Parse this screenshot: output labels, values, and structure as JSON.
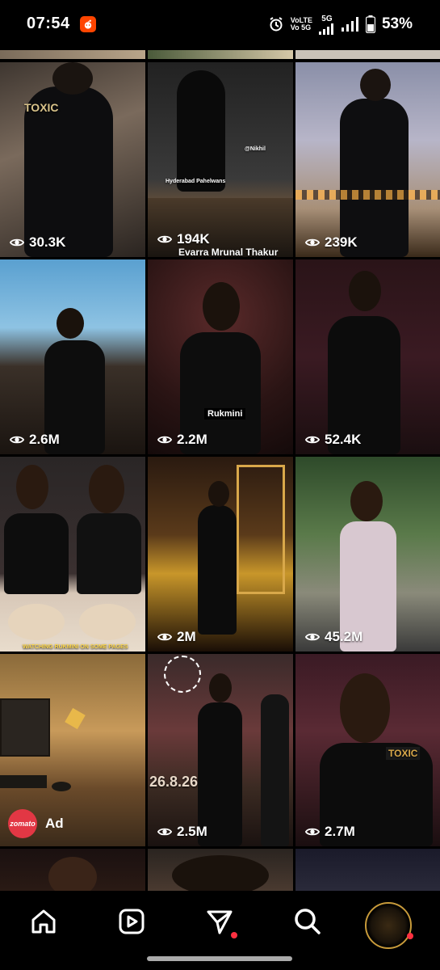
{
  "status_bar": {
    "time": "07:54",
    "app_icon": "reddit-icon",
    "network_volte": "VoLTE",
    "network_vo5g": "Vo 5G",
    "network_5g": "5G",
    "battery_percent": "53%",
    "icons": [
      "alarm-icon",
      "signal-icon",
      "battery-icon"
    ]
  },
  "grid": {
    "tiles": [
      {
        "views": "30.3K",
        "overlay": "TOXIC"
      },
      {
        "views": "194K",
        "overlay": "Evarra Mrunal Thakur",
        "overlay2": "Hyderabad Pahelwans",
        "overlay3": "@Nikhil"
      },
      {
        "views": "239K"
      },
      {
        "views": "2.6M"
      },
      {
        "views": "2.2M",
        "overlay": "Rukmini"
      },
      {
        "views": "52.4K"
      },
      {
        "views": "2M",
        "overlay": "WATCHING RUKMINI ON SOME PAGES"
      },
      {
        "views": "45.2M"
      },
      {
        "ad_label": "Ad",
        "brand": "zomato"
      },
      {
        "views": "2.5M",
        "overlay": "26.8.26"
      },
      {
        "views": "2.7M",
        "overlay": "TOXIC"
      }
    ]
  },
  "bottom_nav": {
    "items": [
      "home-icon",
      "reels-icon",
      "messages-icon",
      "search-icon",
      "profile-avatar"
    ]
  },
  "colors": {
    "background": "#000000",
    "notification": "#ff3040",
    "zomato": "#e23744",
    "reddit": "#ff4500"
  }
}
